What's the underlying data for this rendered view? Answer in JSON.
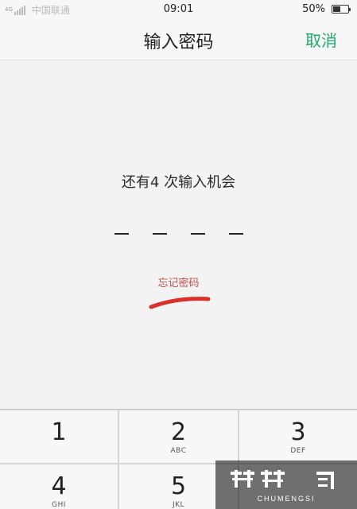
{
  "status_bar": {
    "signal_label": "4G",
    "carrier": "中国联通",
    "time": "09:01",
    "battery_percent": "50%",
    "battery_level": 0.5
  },
  "nav": {
    "title": "输入密码",
    "cancel_label": "取消"
  },
  "lock": {
    "attempts_text": "还有4 次输入机会",
    "pin_length": 4,
    "forgot_label": "忘记密码"
  },
  "keypad": {
    "keys": [
      {
        "digit": "1",
        "letters": ""
      },
      {
        "digit": "2",
        "letters": "ABC"
      },
      {
        "digit": "3",
        "letters": "DEF"
      },
      {
        "digit": "4",
        "letters": "GHI"
      },
      {
        "digit": "5",
        "letters": "JKL"
      }
    ]
  },
  "colors": {
    "accent": "#1aa86b",
    "forgot": "#c0504d",
    "annotation": "#d9302c",
    "keypad_bg": "#d5d5d5",
    "key_bg": "#f7f7f7"
  },
  "watermark": {
    "text": "楚梦",
    "subtext": "CHUMENGSI"
  }
}
